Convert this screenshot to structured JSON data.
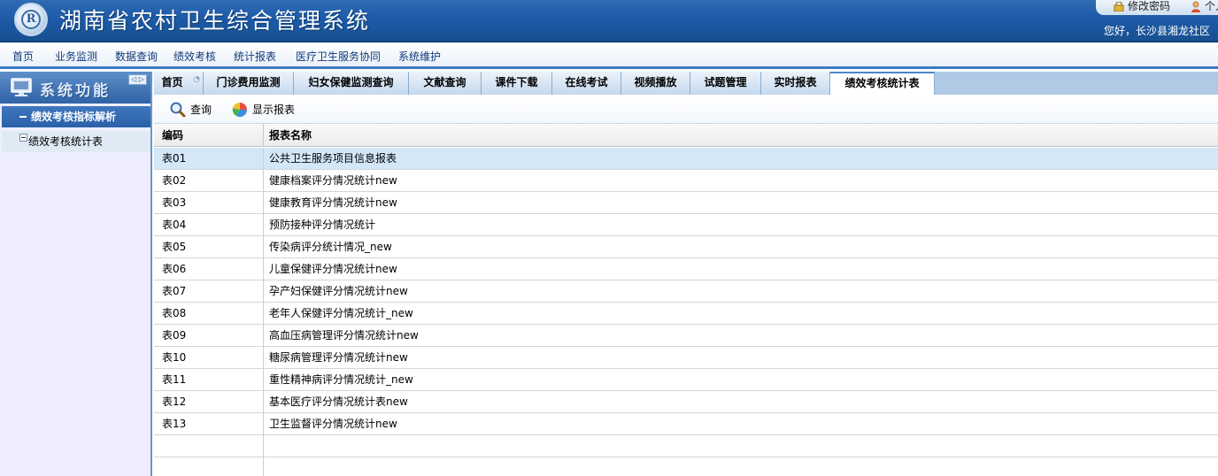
{
  "header": {
    "logo_letter": "R",
    "app_title": "湖南省农村卫生综合管理系统",
    "change_password": "修改密码",
    "user_label": "个人",
    "greeting": "您好，长沙县湘龙社区"
  },
  "menu": [
    {
      "label": "首页"
    },
    {
      "label": "业务监测"
    },
    {
      "label": "数据查询"
    },
    {
      "label": "绩效考核"
    },
    {
      "label": "统计报表"
    },
    {
      "label": "医疗卫生服务协同"
    },
    {
      "label": "系统维护"
    }
  ],
  "left_panel": {
    "title": "系统功能",
    "toggle": "◁ ▷",
    "section": "绩效考核指标解析",
    "items": [
      {
        "label": "绩效考核统计表"
      }
    ]
  },
  "tabs": [
    {
      "label": "首页",
      "closable": true
    },
    {
      "label": "门诊费用监测"
    },
    {
      "label": "妇女保健监测查询"
    },
    {
      "label": "文献查询"
    },
    {
      "label": "课件下载"
    },
    {
      "label": "在线考试"
    },
    {
      "label": "视频播放"
    },
    {
      "label": "试题管理"
    },
    {
      "label": "实时报表"
    },
    {
      "label": "绩效考核统计表",
      "active": true
    }
  ],
  "toolbar": {
    "query_label": "查询",
    "show_report_label": "显示报表"
  },
  "grid": {
    "columns": [
      "编码",
      "报表名称"
    ],
    "rows": [
      {
        "code": "表01",
        "name": "公共卫生服务项目信息报表"
      },
      {
        "code": "表02",
        "name": "健康档案评分情况统计new"
      },
      {
        "code": "表03",
        "name": "健康教育评分情况统计new"
      },
      {
        "code": "表04",
        "name": "预防接种评分情况统计"
      },
      {
        "code": "表05",
        "name": "传染病评分统计情况_new"
      },
      {
        "code": "表06",
        "name": "儿童保健评分情况统计new"
      },
      {
        "code": "表07",
        "name": "孕产妇保健评分情况统计new"
      },
      {
        "code": "表08",
        "name": "老年人保健评分情况统计_new"
      },
      {
        "code": "表09",
        "name": "高血压病管理评分情况统计new"
      },
      {
        "code": "表10",
        "name": "糖尿病管理评分情况统计new"
      },
      {
        "code": "表11",
        "name": "重性精神病评分情况统计_new"
      },
      {
        "code": "表12",
        "name": "基本医疗评分情况统计表new"
      },
      {
        "code": "表13",
        "name": "卫生监督评分情况统计new"
      },
      {
        "code": "",
        "name": ""
      },
      {
        "code": "",
        "name": ""
      }
    ]
  }
}
